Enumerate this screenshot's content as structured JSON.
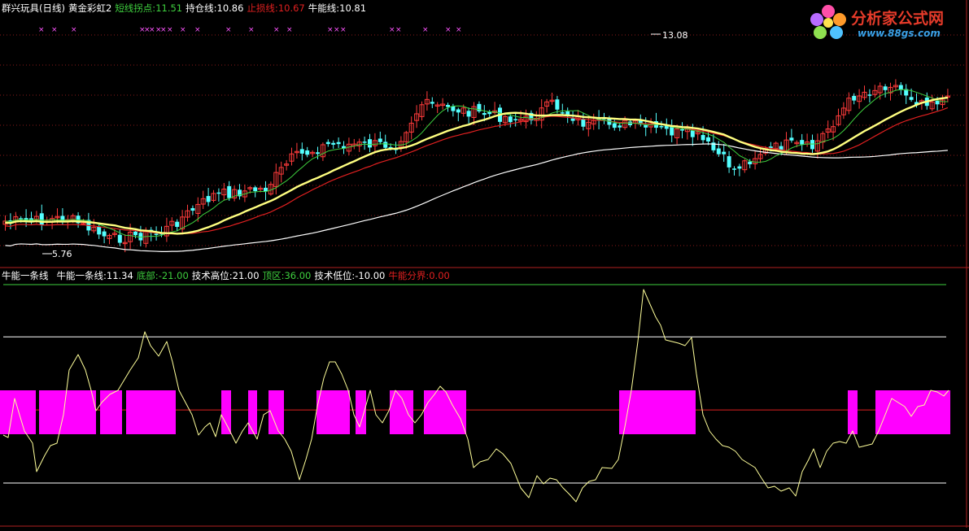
{
  "colors": {
    "bg": "#000000",
    "up": "#ff3b3b",
    "down": "#54ffff",
    "ma_short": "#3ecf3e",
    "ma_hold": "#ffffff",
    "ma_stop": "#e02020",
    "ma_bull": "#ffff80",
    "oscillator": "#ffff9a",
    "fill": "#ff00ff",
    "marker": "#ff55ff",
    "border": "#b02020"
  },
  "header_main": {
    "title": "群兴玩具(日线)",
    "indicator": "黄金彩虹2",
    "short_label": "短线拐点:",
    "short_value": "11.51",
    "hold_label": "持仓线:",
    "hold_value": "10.86",
    "stop_label": "止损线:",
    "stop_value": "10.67",
    "bull_label": "牛能线:",
    "bull_value": "10.81"
  },
  "header_sub": {
    "name": "牛能一条线",
    "line_label": "牛能一条线:",
    "line_value": "11.34",
    "bottom_label": "底部:",
    "bottom_value": "-21.00",
    "high_label": "技术高位:",
    "high_value": "21.00",
    "top_label": "顶区:",
    "top_value": "36.00",
    "low_label": "技术低位:",
    "low_value": "-10.00",
    "divide_label": "牛能分界:",
    "divide_value": "0.00"
  },
  "logo": {
    "name": "分析家公式网",
    "url_text": "www.88gs.com"
  },
  "chart_data": [
    {
      "type": "candlestick",
      "annotations": [
        {
          "label": "5.76",
          "kind": "low"
        },
        {
          "label": "13.08",
          "kind": "high"
        }
      ],
      "series_style": [
        "短线拐点",
        "持仓线",
        "止损线",
        "牛能线"
      ]
    },
    {
      "type": "line",
      "levels": [
        {
          "name": "顶区",
          "value": 36
        },
        {
          "name": "技术高位",
          "value": 21
        },
        {
          "name": "牛能分界",
          "value": 0
        },
        {
          "name": "技术低位",
          "value": -10
        },
        {
          "name": "底部",
          "value": -21
        }
      ],
      "ylim": [
        -34,
        36
      ]
    }
  ]
}
